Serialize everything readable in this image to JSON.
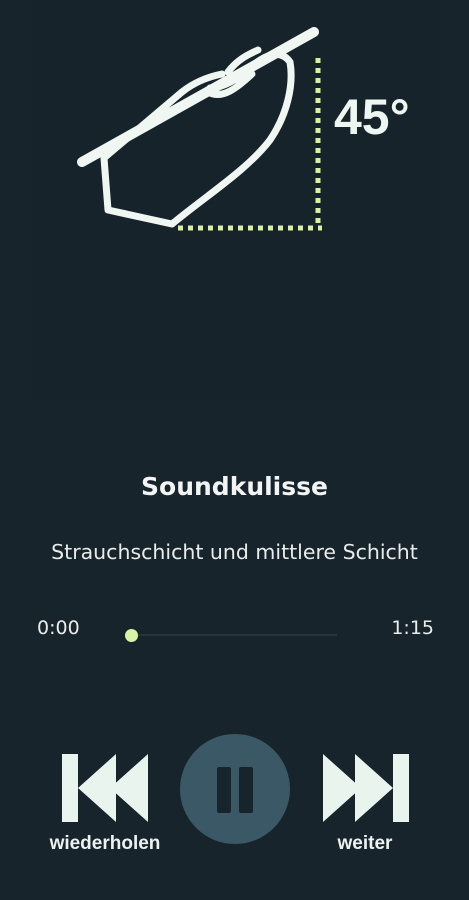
{
  "illustration": {
    "angle": "45°",
    "icon": "hand-tilt-icon",
    "stroke_color": "#f0f7f2",
    "dots_color": "#d8f0a0"
  },
  "player": {
    "title": "Soundkulisse",
    "subtitle": "Strauchschicht und mittlere Schicht",
    "current_time": "0:00",
    "total_time": "1:15",
    "progress": 0
  },
  "controls": {
    "previous_label": "wiederholen",
    "next_label": "weiter",
    "previous_icon": "skip-back-icon",
    "pause_icon": "pause-icon",
    "next_icon": "skip-forward-icon"
  },
  "colors": {
    "background": "#17242b",
    "accent": "#d8f2a8",
    "pause_button": "#3b5866"
  }
}
